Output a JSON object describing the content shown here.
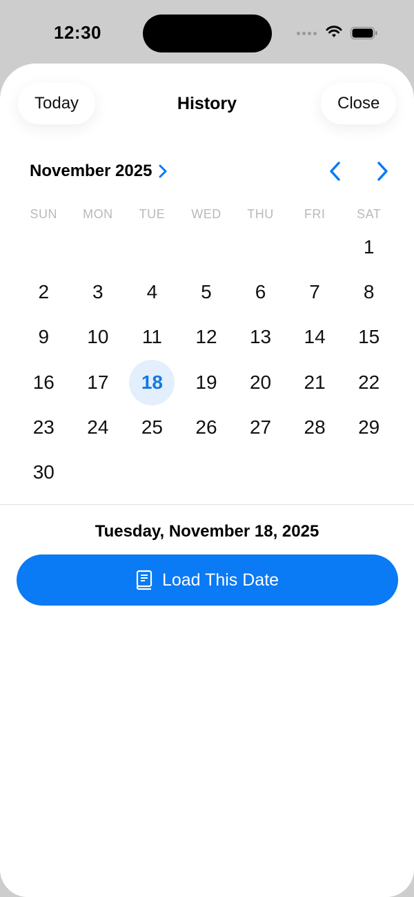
{
  "status_bar": {
    "time": "12:30"
  },
  "header": {
    "today_label": "Today",
    "title": "History",
    "close_label": "Close"
  },
  "calendar": {
    "month_label": "November 2025",
    "weekdays": [
      "SUN",
      "MON",
      "TUE",
      "WED",
      "THU",
      "FRI",
      "SAT"
    ],
    "leading_blanks": 6,
    "days": [
      "1",
      "2",
      "3",
      "4",
      "5",
      "6",
      "7",
      "8",
      "9",
      "10",
      "11",
      "12",
      "13",
      "14",
      "15",
      "16",
      "17",
      "18",
      "19",
      "20",
      "21",
      "22",
      "23",
      "24",
      "25",
      "26",
      "27",
      "28",
      "29",
      "30"
    ],
    "selected_day": "18",
    "selected_date_text": "Tuesday, November 18, 2025"
  },
  "actions": {
    "load_label": "Load This Date",
    "load_icon": "book-icon"
  },
  "colors": {
    "accent": "#0a7af5",
    "selected_bg": "#e3effc",
    "selected_text": "#1479e3"
  }
}
